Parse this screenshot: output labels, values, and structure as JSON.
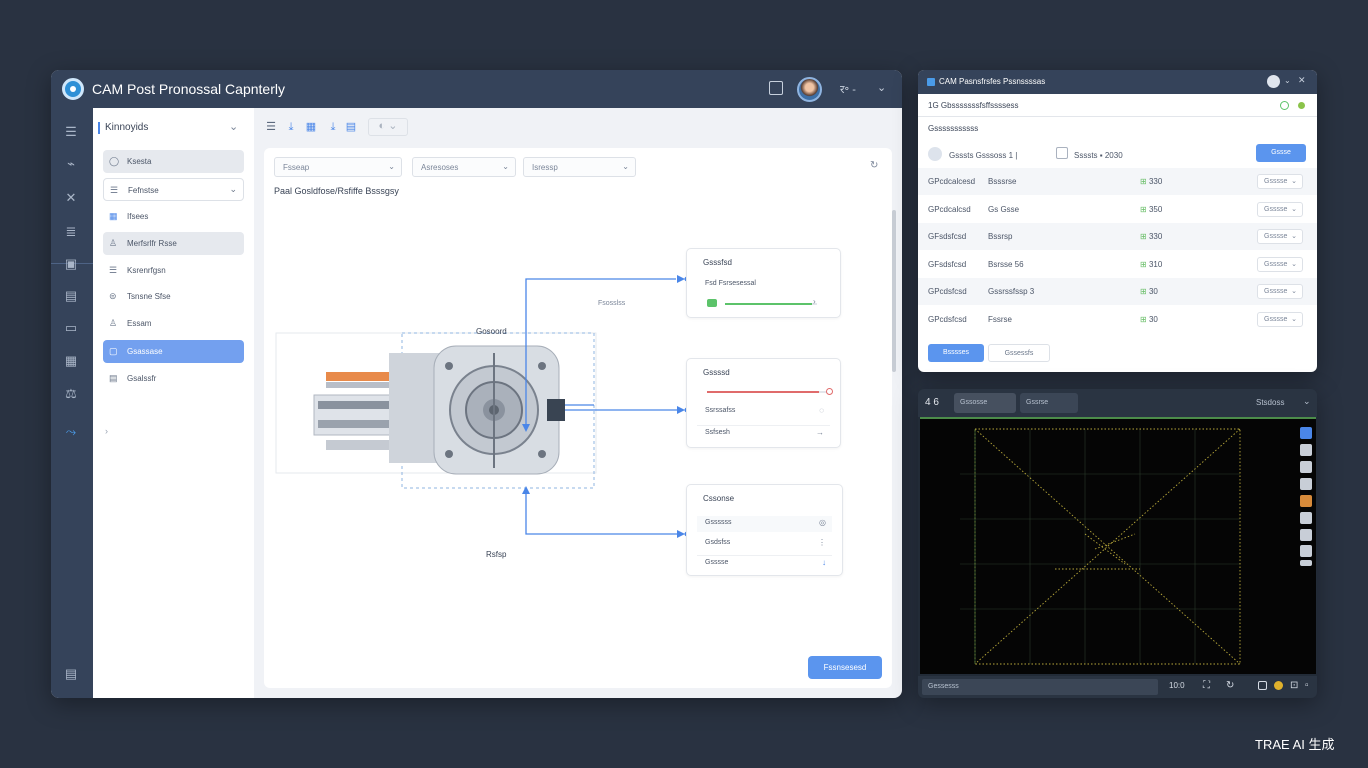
{
  "main_window": {
    "title": "CAM Post Pronossal Capnterly",
    "titlebar_icons": [
      "window-toggle-icon",
      "avatar",
      "language-icon",
      "chevron-down-icon"
    ],
    "language_label": "र॰ -"
  },
  "rail": {
    "icons": [
      "list-icon",
      "chart-icon",
      "tool-icon",
      "layers-icon",
      "image-icon",
      "database-icon",
      "monitor-icon",
      "grid-icon",
      "balance-icon",
      "link-icon",
      "logout-icon"
    ]
  },
  "nav": {
    "header": "Kinnoyids",
    "items": [
      {
        "label": "Ksesta",
        "style": "grey"
      },
      {
        "label": "Fefnstse",
        "style": "outline"
      },
      {
        "label": "Ifsees",
        "style": "plain"
      },
      {
        "label": "Merfsrlfr Rsse",
        "style": "grey"
      },
      {
        "label": "Ksrenrfgsn",
        "style": "plain"
      },
      {
        "label": "Tsnsne Sfse",
        "style": "plain"
      },
      {
        "label": "Essam",
        "style": "plain"
      },
      {
        "label": "Gsassase",
        "style": "active"
      },
      {
        "label": "Gsalssfr",
        "style": "plain"
      }
    ]
  },
  "canvas": {
    "select_1": "Fsseap",
    "select_2": "Asresoses",
    "select_3": "Isressp",
    "label": "Paal Gosldfose/Rsfiffe Bsssgsy",
    "machine_label_top": "Gosoord",
    "machine_label_bottom": "Rsfsp",
    "connector_label": "Fsosslss",
    "apply_button": "Fssnsesesd",
    "card_1": {
      "title": "Gsssfsd",
      "row_1": "Fsd Fsrsesessal",
      "slider_fill": 0.95
    },
    "card_2": {
      "title": "Gssssd",
      "row_1": "Ssrssafss",
      "row_2": "Ssfsesh",
      "slider_fill": 0.92
    },
    "card_3": {
      "title": "Cssonse",
      "row_1": "Gssssss",
      "row_2": "Gsdsfss",
      "row_3": "Gsssse"
    }
  },
  "params": {
    "title": "CAM Pasnsfrsfes Pssnssssas",
    "subtitle": "1G  Gbsssssssfsffssssess",
    "section": "Gsssssssssss",
    "toolbar_text": "Gsssts  Gsssoss  1  |",
    "toolbar_value": "Ssssts  ▪  2030",
    "toolbar_button": "Gssse",
    "rows": [
      {
        "name": "GPcdcalcesd",
        "type": "Bsssrse",
        "value": "330"
      },
      {
        "name": "GPcdcalcsd",
        "type": "Gs Gsse",
        "value": "350"
      },
      {
        "name": "GFsdsfcsd",
        "type": "Bssrsp",
        "value": "330"
      },
      {
        "name": "GFsdsfcsd",
        "type": "Bsrsse 56",
        "value": "310"
      },
      {
        "name": "GPcdsfcsd",
        "type": "Gssrssfssp 3",
        "value": "30"
      },
      {
        "name": "GPcdsfcsd",
        "type": "Fssrse",
        "value": "30"
      }
    ],
    "row_select": "Gsssse",
    "btn_primary": "Bsssses",
    "btn_secondary": "Gssessfs"
  },
  "viewer": {
    "label": "4  6",
    "tab_1": "Gssosse",
    "tab_2": "Gssrse",
    "view_mode": "Stsdoss",
    "status_text": "Gessesss",
    "zoom": "10:0",
    "toolbox_icons": [
      "select-icon",
      "folder-icon",
      "cursor-icon",
      "layers-icon",
      "pin-icon",
      "print-icon",
      "copy-icon",
      "stack-icon",
      "bar-icon"
    ]
  },
  "watermark": "TRAE AI 生成",
  "colors": {
    "accent": "#5b95ee",
    "titlebar": "#35435a",
    "background": "#293241",
    "toolpath": "#c8c04a"
  }
}
